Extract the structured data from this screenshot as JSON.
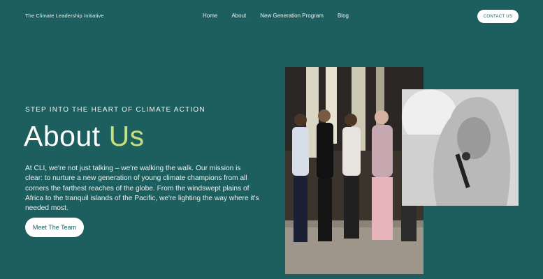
{
  "brand": "The Climate Leadership Initiative",
  "nav": [
    "Home",
    "About",
    "New Generation Program",
    "Blog"
  ],
  "contact_label": "CONTACT US",
  "eyebrow": "STEP INTO THE HEART OF CLIMATE ACTION",
  "title": {
    "main": "About",
    "accent": "Us"
  },
  "lead": "At CLI, we're not just talking – we're walking the walk. Our mission is clear: to nurture a new generation of young climate champions from all corners the farthest reaches of the globe. From the windswept plains of Africa to the tranquil islands of the Pacific, we're lighting the way where it's needed most.",
  "cta_label": "Meet The Team",
  "colors": {
    "background": "#1d5e5f",
    "accent": "#c6df7e",
    "button": "#ffffff"
  }
}
